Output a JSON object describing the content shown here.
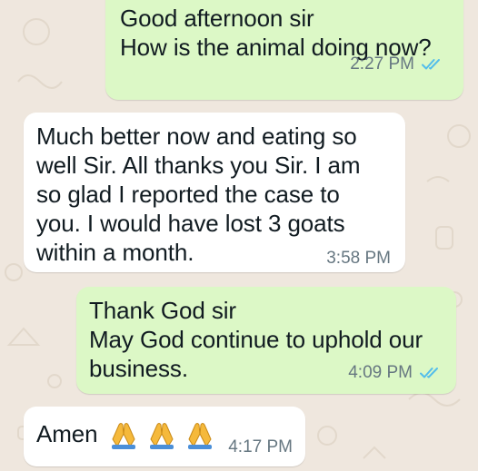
{
  "colors": {
    "outgoing_bubble": "#dcf8c6",
    "incoming_bubble": "#ffffff",
    "wallpaper": "#efe7de",
    "timestamp": "#667781",
    "read_ticks": "#53bdeb"
  },
  "messages": [
    {
      "direction": "outgoing",
      "text": "Good afternoon sir\nHow is the animal doing now?",
      "time": "2:27 PM",
      "status_icon": "double-check-read-icon"
    },
    {
      "direction": "incoming",
      "text": "Much better now and eating so\nwell Sir. All thanks you Sir. I am\nso glad I reported the case to\nyou. I would have lost 3 goats\nwithin a month.",
      "time": "3:58 PM"
    },
    {
      "direction": "outgoing",
      "text": "Thank God sir\nMay God continue to uphold our\nbusiness.",
      "time": "4:09 PM",
      "status_icon": "double-check-read-icon"
    },
    {
      "direction": "incoming",
      "text": "Amen",
      "emoji_icons": [
        "folded-hands-icon",
        "folded-hands-icon",
        "folded-hands-icon"
      ],
      "time": "4:17 PM"
    }
  ]
}
